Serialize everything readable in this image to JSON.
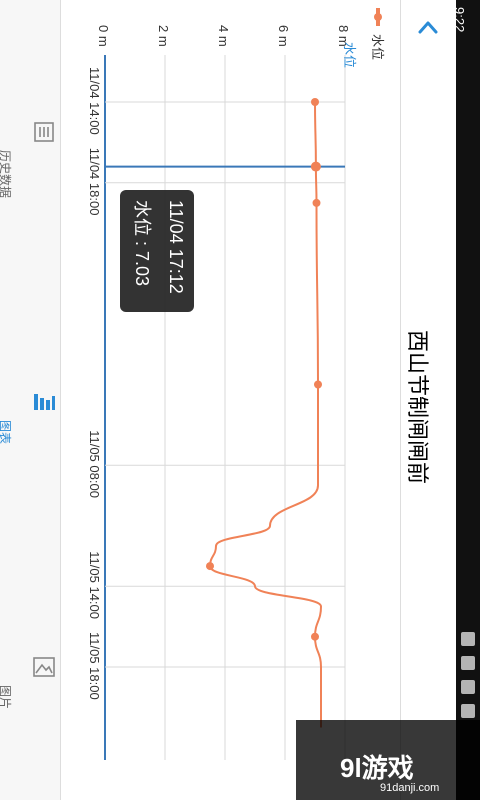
{
  "status_bar": {
    "time": "9:22"
  },
  "header": {
    "title": "西山节制闸闸前",
    "back_icon": "chevron-left-icon"
  },
  "legend": {
    "series_name": "水位",
    "series_tag": "水位",
    "color": "#f08257"
  },
  "tooltip": {
    "time": "11/04 17:12",
    "value": "水位 : 7.03"
  },
  "nav": [
    {
      "label": "历史数据",
      "icon": "list-icon",
      "active": false
    },
    {
      "label": "图表",
      "icon": "bar-chart-icon",
      "active": true
    },
    {
      "label": "图片",
      "icon": "image-icon",
      "active": false
    }
  ],
  "watermark": {
    "main": "9l游戏",
    "sub": "91danji.com"
  },
  "chart_data": {
    "type": "line",
    "orientation": "rotated-90",
    "series": [
      {
        "name": "水位",
        "color": "#f08257",
        "points": [
          {
            "x": "11/04 14:00",
            "y": 7.0
          },
          {
            "x": "11/04 17:12",
            "y": 7.03
          },
          {
            "x": "11/04 19:00",
            "y": 7.05
          },
          {
            "x": "11/05 04:00",
            "y": 7.1
          },
          {
            "x": "11/05 09:00",
            "y": 7.1
          },
          {
            "x": "11/05 11:00",
            "y": 5.5
          },
          {
            "x": "11/05 12:00",
            "y": 3.7
          },
          {
            "x": "11/05 13:00",
            "y": 3.5
          },
          {
            "x": "11/05 14:00",
            "y": 5.0
          },
          {
            "x": "11/05 15:00",
            "y": 7.2
          },
          {
            "x": "11/05 16:30",
            "y": 7.0
          },
          {
            "x": "11/05 18:00",
            "y": 7.2
          },
          {
            "x": "11/05 21:00",
            "y": 7.2
          }
        ],
        "marked_points": [
          "11/04 14:00",
          "11/04 17:12",
          "11/04 19:00",
          "11/05 04:00",
          "11/05 13:00",
          "11/05 16:30"
        ]
      }
    ],
    "x_ticks": [
      "11/04 14:00",
      "11/04 18:00",
      "11/05 08:00",
      "11/05 14:00",
      "11/05 18:00"
    ],
    "y_ticks": [
      "0 m",
      "2 m",
      "4 m",
      "6 m",
      "8 m"
    ],
    "ylim": [
      0,
      8
    ],
    "grid": true,
    "legend": "top"
  }
}
